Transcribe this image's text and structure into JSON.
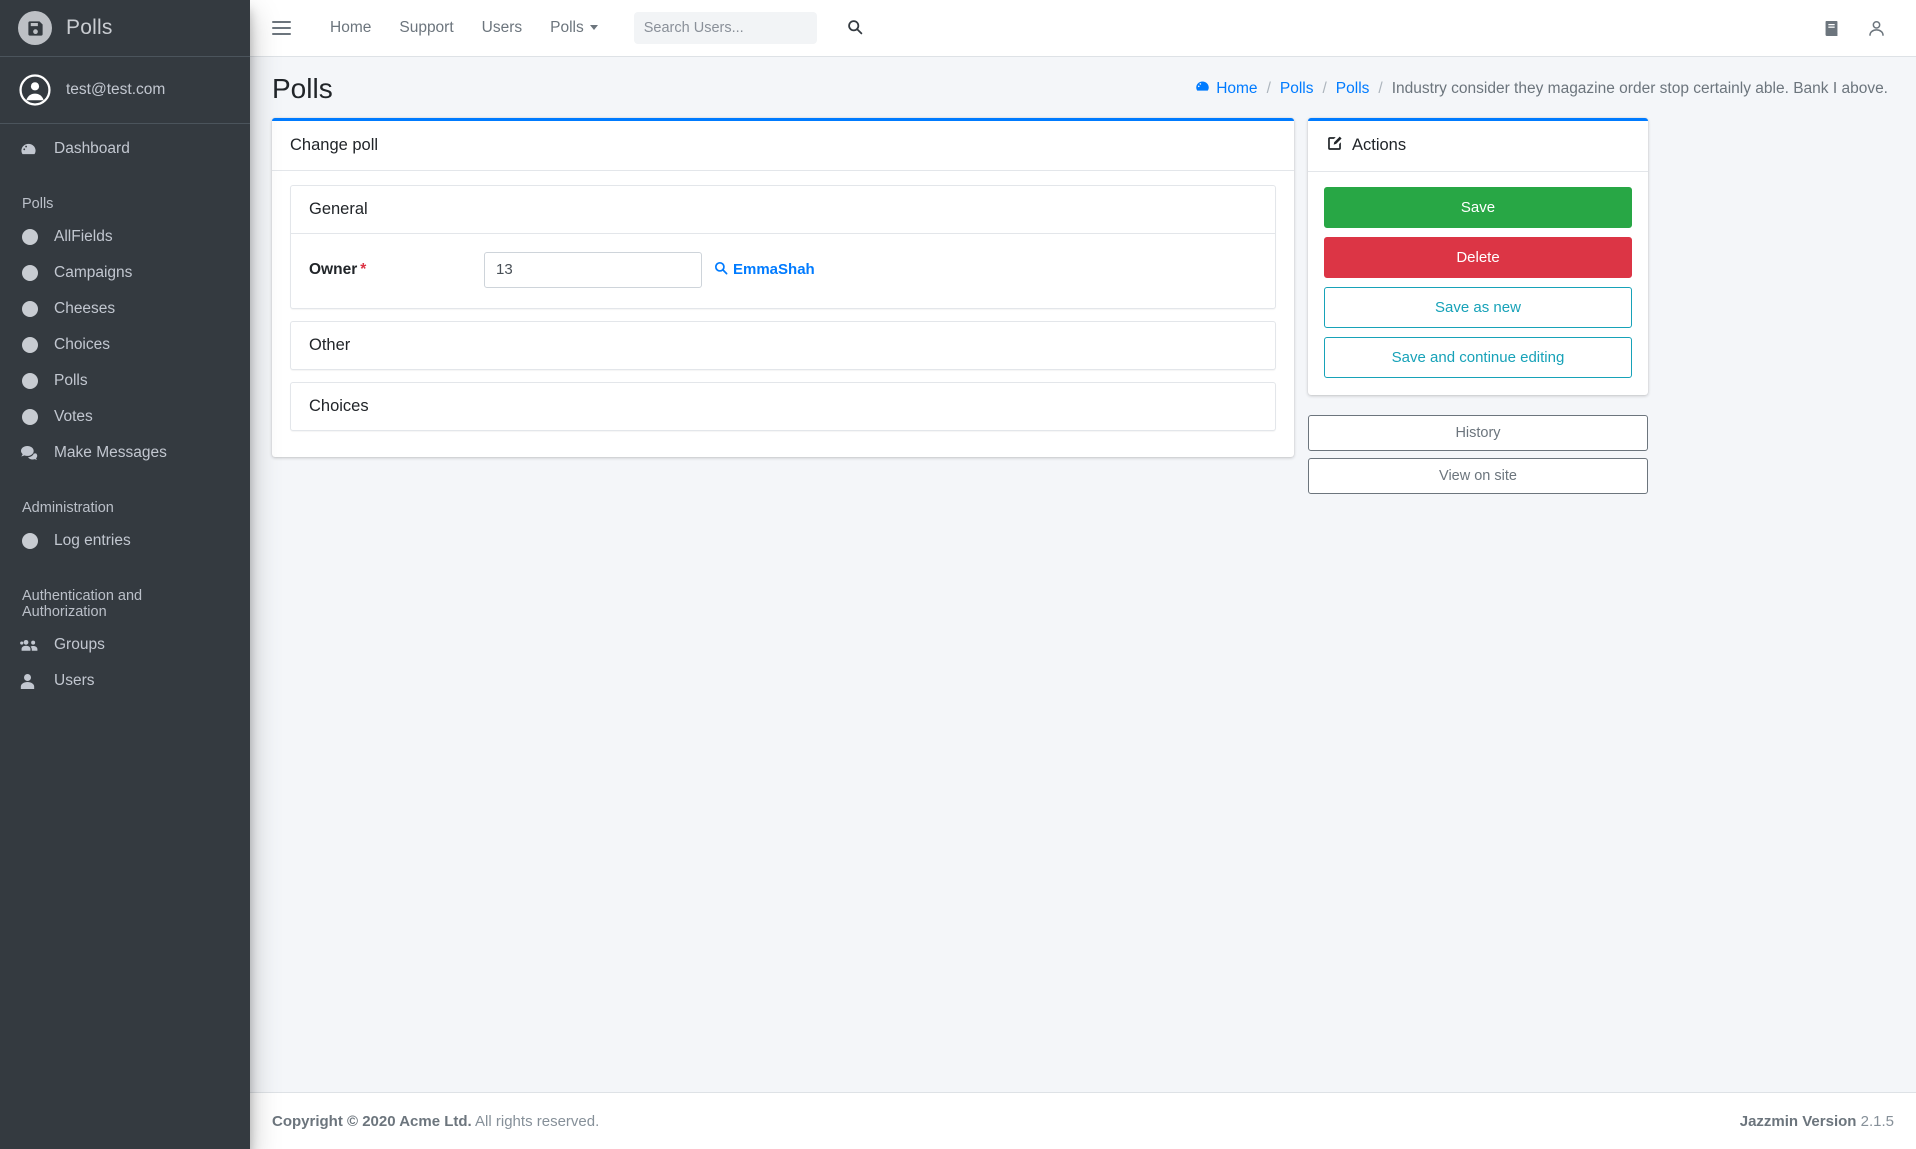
{
  "brand": {
    "title": "Polls",
    "logo_icon": "save-disk-icon"
  },
  "user_panel": {
    "email": "test@test.com",
    "avatar_icon": "user-circle-icon"
  },
  "sidebar": {
    "items": [
      {
        "label": "Dashboard",
        "icon": "tachometer-icon",
        "type": "link"
      },
      {
        "label": "Polls",
        "type": "header"
      },
      {
        "label": "AllFields",
        "icon": "circle-icon",
        "type": "link"
      },
      {
        "label": "Campaigns",
        "icon": "circle-icon",
        "type": "link"
      },
      {
        "label": "Cheeses",
        "icon": "circle-icon",
        "type": "link"
      },
      {
        "label": "Choices",
        "icon": "circle-icon",
        "type": "link"
      },
      {
        "label": "Polls",
        "icon": "circle-icon",
        "type": "link"
      },
      {
        "label": "Votes",
        "icon": "circle-icon",
        "type": "link"
      },
      {
        "label": "Make Messages",
        "icon": "comments-icon",
        "type": "link"
      },
      {
        "label": "Administration",
        "type": "header"
      },
      {
        "label": "Log entries",
        "icon": "circle-icon",
        "type": "link"
      },
      {
        "label": "Authentication and Authorization",
        "type": "header"
      },
      {
        "label": "Groups",
        "icon": "users-group-icon",
        "type": "link"
      },
      {
        "label": "Users",
        "icon": "user-icon",
        "type": "link"
      }
    ]
  },
  "navbar": {
    "menu_icon": "hamburger-icon",
    "links": [
      {
        "label": "Home",
        "dropdown": false
      },
      {
        "label": "Support",
        "dropdown": false
      },
      {
        "label": "Users",
        "dropdown": false
      },
      {
        "label": "Polls",
        "dropdown": true
      }
    ],
    "search": {
      "placeholder": "Search Users...",
      "value": "",
      "icon": "search-icon"
    },
    "right_icons": [
      {
        "name": "book-icon"
      },
      {
        "name": "user-icon"
      }
    ]
  },
  "page": {
    "title": "Polls"
  },
  "breadcrumb": {
    "home_icon": "dashboard-icon",
    "items": [
      {
        "label": "Home",
        "link": true
      },
      {
        "label": "Polls",
        "link": true
      },
      {
        "label": "Polls",
        "link": true
      },
      {
        "label": "Industry consider they magazine order stop certainly able. Bank I above.",
        "link": false
      }
    ],
    "separator": "/"
  },
  "main_card": {
    "title": "Change poll",
    "fieldsets": [
      {
        "name": "General",
        "collapsed": false,
        "fields": [
          {
            "label": "Owner",
            "required": true,
            "required_marker": "*",
            "value": "13",
            "lookup_icon": "search-icon",
            "lookup_label": "EmmaShah"
          }
        ]
      },
      {
        "name": "Other",
        "collapsed": true,
        "fields": []
      },
      {
        "name": "Choices",
        "collapsed": true,
        "fields": []
      }
    ]
  },
  "actions_panel": {
    "title": "Actions",
    "title_icon": "edit-pen-icon",
    "buttons": [
      {
        "label": "Save",
        "style": "success"
      },
      {
        "label": "Delete",
        "style": "danger"
      },
      {
        "label": "Save as new",
        "style": "outline-info"
      },
      {
        "label": "Save and continue editing",
        "style": "outline-info"
      }
    ],
    "secondary_buttons": [
      {
        "label": "History"
      },
      {
        "label": "View on site"
      }
    ]
  },
  "footer": {
    "copyright_bold": "Copyright © 2020 Acme Ltd.",
    "copyright_rest": "All rights reserved.",
    "version_label": "Jazzmin Version",
    "version_number": "2.1.5"
  },
  "colors": {
    "sidebar_bg": "#343a40",
    "accent": "#007bff",
    "success": "#28a745",
    "danger": "#dc3545",
    "info": "#17a2b8",
    "content_bg": "#f4f6f9"
  }
}
